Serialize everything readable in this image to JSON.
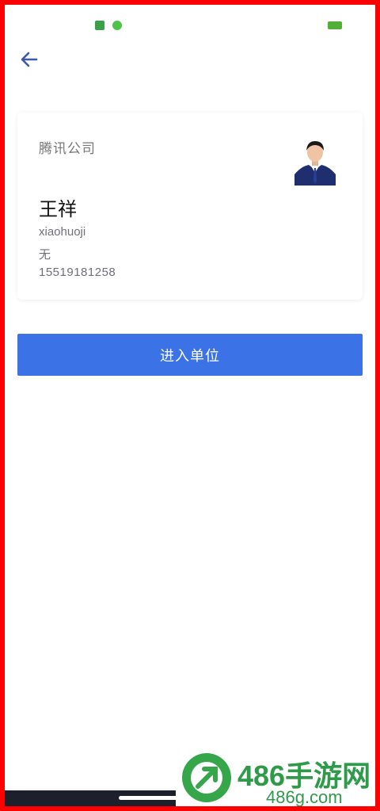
{
  "header": {
    "back_icon": "arrow-left-icon"
  },
  "card": {
    "company": "腾讯公司",
    "name": "王祥",
    "username": "xiaohuoji",
    "department": "无",
    "phone": "15519181258"
  },
  "actions": {
    "enter_label": "进入单位"
  },
  "watermark": {
    "title": "486手游网",
    "site": "486g.com"
  },
  "colors": {
    "primary": "#3b72e6",
    "frame": "#ff0000"
  }
}
